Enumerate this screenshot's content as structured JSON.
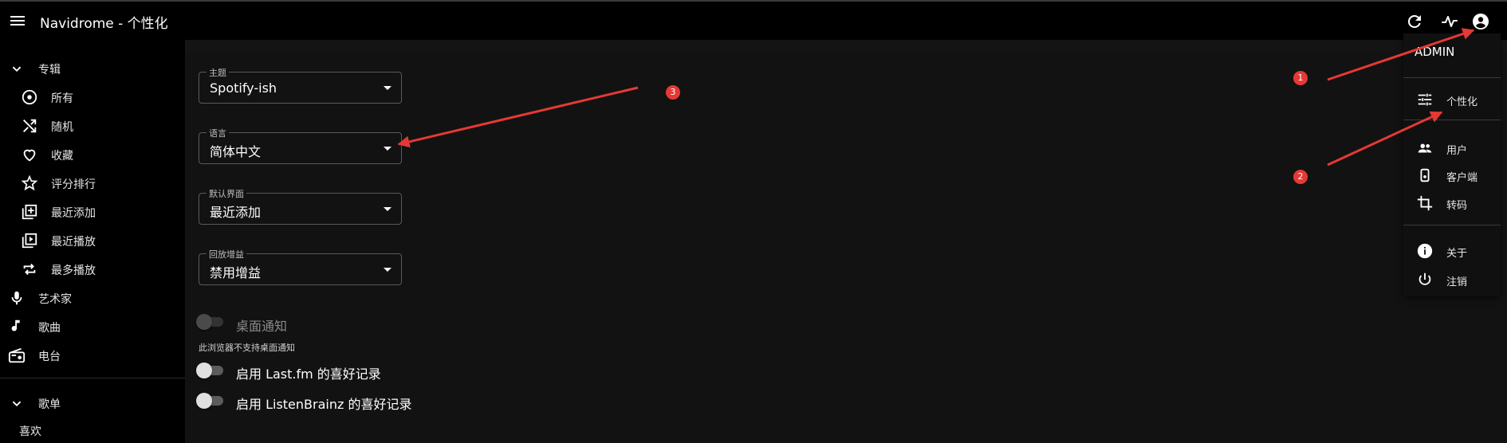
{
  "appbar": {
    "title": "Navidrome - 个性化",
    "icons": [
      "menu-icon",
      "refresh-icon",
      "activity-icon",
      "account-circle-icon"
    ]
  },
  "sidebar": {
    "album_section": "专辑",
    "album_items": [
      {
        "label": "所有",
        "icon": "album-icon"
      },
      {
        "label": "随机",
        "icon": "shuffle-icon"
      },
      {
        "label": "收藏",
        "icon": "heart-icon"
      },
      {
        "label": "评分排行",
        "icon": "star-icon"
      },
      {
        "label": "最近添加",
        "icon": "library-add-icon"
      },
      {
        "label": "最近播放",
        "icon": "video-library-icon"
      },
      {
        "label": "最多播放",
        "icon": "repeat-icon"
      }
    ],
    "top_items": [
      {
        "label": "艺术家",
        "icon": "mic-icon"
      },
      {
        "label": "歌曲",
        "icon": "music-note-icon"
      },
      {
        "label": "电台",
        "icon": "radio-icon"
      }
    ],
    "playlist_section": "歌单",
    "playlist_first": "喜欢"
  },
  "form": {
    "theme": {
      "label": "主题",
      "value": "Spotify-ish"
    },
    "language": {
      "label": "语言",
      "value": "简体中文"
    },
    "default_view": {
      "label": "默认界面",
      "value": "最近添加"
    },
    "replay_gain": {
      "label": "回放增益",
      "value": "禁用增益"
    },
    "desktop_notify": {
      "label": "桌面通知",
      "helper": "此浏览器不支持桌面通知",
      "enabled": false
    },
    "lastfm": {
      "label": "启用 Last.fm 的喜好记录",
      "on": false
    },
    "listenbrainz": {
      "label": "启用 ListenBrainz 的喜好记录",
      "on": false
    }
  },
  "user_menu": {
    "username": "ADMIN",
    "items": [
      {
        "label": "个性化",
        "icon": "tune-icon"
      },
      {
        "label": "用户",
        "icon": "people-icon"
      },
      {
        "label": "客户端",
        "icon": "device-icon"
      },
      {
        "label": "转码",
        "icon": "crop-icon"
      },
      {
        "label": "关于",
        "icon": "info-icon"
      },
      {
        "label": "注销",
        "icon": "power-icon"
      }
    ]
  },
  "annotations": {
    "n1": "1",
    "n2": "2",
    "n3": "3",
    "color": "#e53935"
  }
}
